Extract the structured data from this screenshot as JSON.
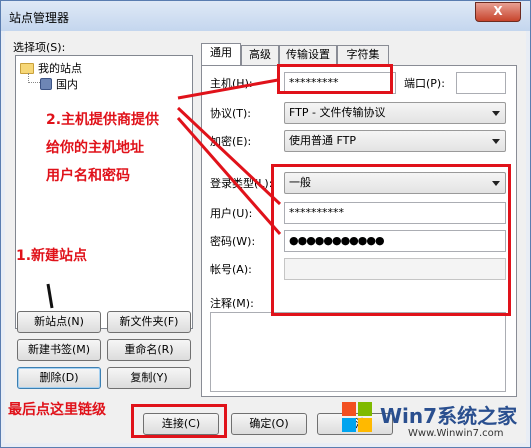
{
  "window": {
    "title": "站点管理器",
    "close_symbol": "X"
  },
  "site_list": {
    "label": "选择项(S):",
    "items": [
      {
        "label": "我的站点"
      },
      {
        "label": "国内"
      }
    ]
  },
  "left_buttons": {
    "new_site": "新站点(N)",
    "new_folder": "新文件夹(F)",
    "new_bookmark": "新建书签(M)",
    "rename": "重命名(R)",
    "delete": "删除(D)",
    "copy": "复制(Y)"
  },
  "tabs": [
    "通用",
    "高级",
    "传输设置",
    "字符集"
  ],
  "general": {
    "host_label": "主机(H):",
    "host_value": "*********",
    "port_label": "端口(P):",
    "port_value": "",
    "protocol_label": "协议(T):",
    "protocol_value": "FTP - 文件传输协议",
    "encryption_label": "加密(E):",
    "encryption_value": "使用普通 FTP",
    "logon_label": "登录类型(L):",
    "logon_value": "一般",
    "user_label": "用户(U):",
    "user_value": "**********",
    "password_label": "密码(W):",
    "password_value": "●●●●●●●●●●●",
    "account_label": "帐号(A):",
    "account_value": "",
    "comment_label": "注释(M):"
  },
  "bottom_buttons": {
    "connect": "连接(C)",
    "ok": "确定(O)",
    "cancel": "取消"
  },
  "annotations": {
    "step1": "1.新建站点",
    "step2_line1": "2.主机提供商提供",
    "step2_line2": "给你的主机地址",
    "step2_line3": "用户名和密码",
    "step3": "最后点这里链级"
  },
  "watermark": {
    "brand": "Win7系统之家",
    "url": "Www.Winwin7.com"
  },
  "colors": {
    "annotation_red": "#e0121a",
    "title_bar": "#c4d6ee"
  }
}
